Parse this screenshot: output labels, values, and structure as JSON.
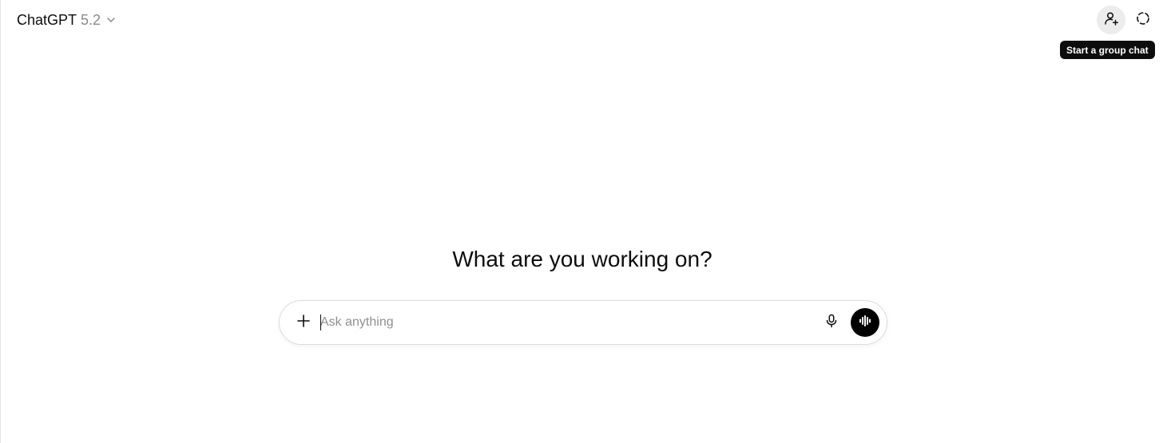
{
  "header": {
    "model_name": "ChatGPT",
    "model_version": "5.2",
    "model_menu_icon": "chevron-down-icon",
    "group_chat_icon": "add-person-icon",
    "temporary_chat_icon": "dashed-circle-icon",
    "tooltip": "Start a group chat"
  },
  "main": {
    "heading": "What are you working on?"
  },
  "composer": {
    "placeholder": "Ask anything",
    "value": "",
    "attach_icon": "plus-icon",
    "mic_icon": "microphone-icon",
    "voice_icon": "voice-waveform-icon"
  },
  "colors": {
    "background": "#ffffff",
    "text": "#0d0d0d",
    "muted": "#8a8a8a",
    "tooltip_bg": "#0d0d0d",
    "voice_button_bg": "#000000",
    "group_button_bg": "#ececec"
  }
}
